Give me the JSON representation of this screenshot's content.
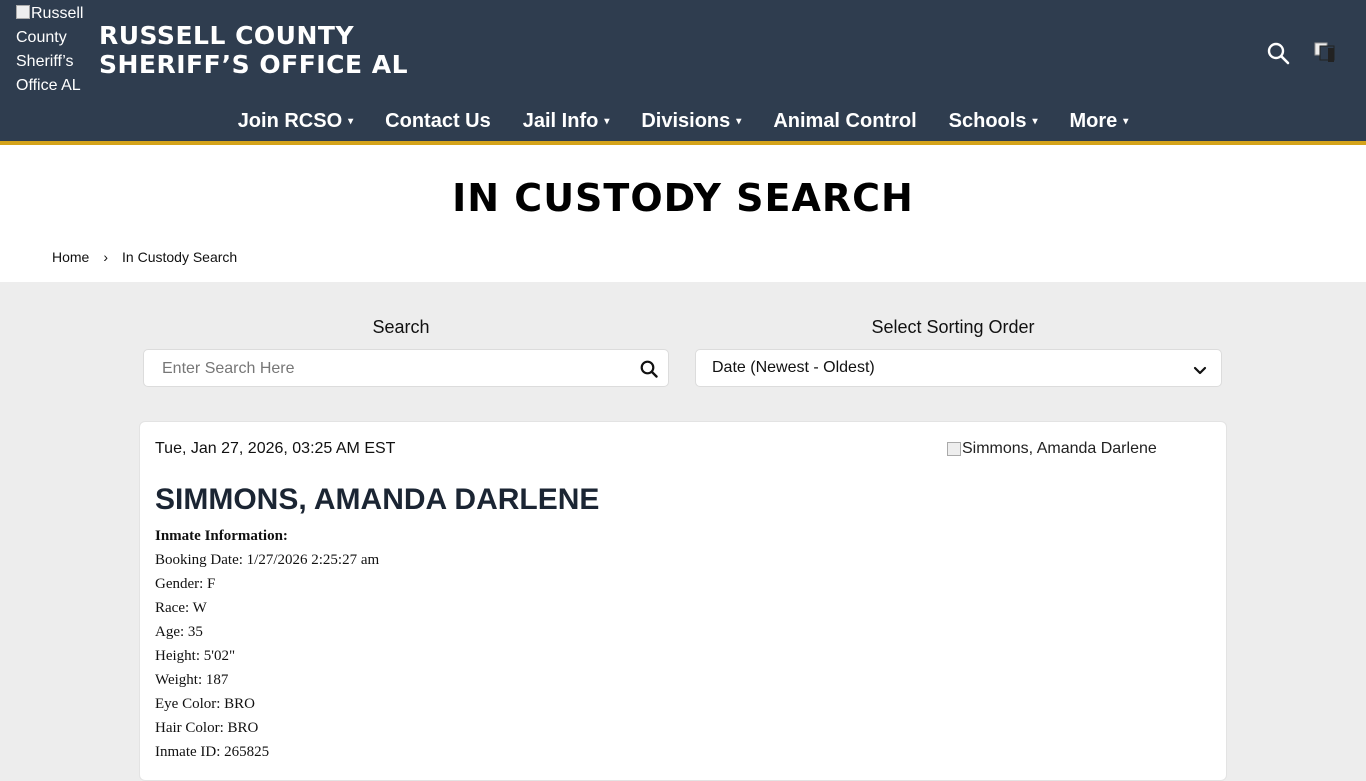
{
  "header": {
    "logo_alt": "Russell County Sheriff’s Office AL",
    "brand_line1": "RUSSELL COUNTY",
    "brand_line2": "SHERIFF’S OFFICE AL",
    "accent_color": "#d4a31a",
    "background_color": "#2f3d4f"
  },
  "nav": {
    "items": [
      {
        "label": "Join RCSO",
        "dropdown": true
      },
      {
        "label": "Contact Us",
        "dropdown": false
      },
      {
        "label": "Jail Info",
        "dropdown": true
      },
      {
        "label": "Divisions",
        "dropdown": true
      },
      {
        "label": "Animal Control",
        "dropdown": false
      },
      {
        "label": "Schools",
        "dropdown": true
      },
      {
        "label": "More",
        "dropdown": true
      }
    ],
    "caret": "▾"
  },
  "page": {
    "title": "IN CUSTODY SEARCH"
  },
  "breadcrumb": {
    "home": "Home",
    "separator": "›",
    "current": "In Custody Search"
  },
  "search": {
    "label": "Search",
    "placeholder": "Enter Search Here"
  },
  "sort": {
    "label": "Select Sorting Order",
    "selected": "Date (Newest - Oldest)"
  },
  "record": {
    "datetime": "Tue, Jan 27, 2026, 03:25 AM EST",
    "photo_alt": "Simmons, Amanda Darlene",
    "name": "SIMMONS, AMANDA DARLENE",
    "info_heading": "Inmate Information:",
    "fields": [
      "Booking Date: 1/27/2026 2:25:27 am",
      "Gender: F",
      "Race: W",
      "Age: 35",
      "Height: 5'02\"",
      "Weight: 187",
      "Eye Color: BRO",
      "Hair Color: BRO",
      "Inmate ID: 265825"
    ]
  }
}
